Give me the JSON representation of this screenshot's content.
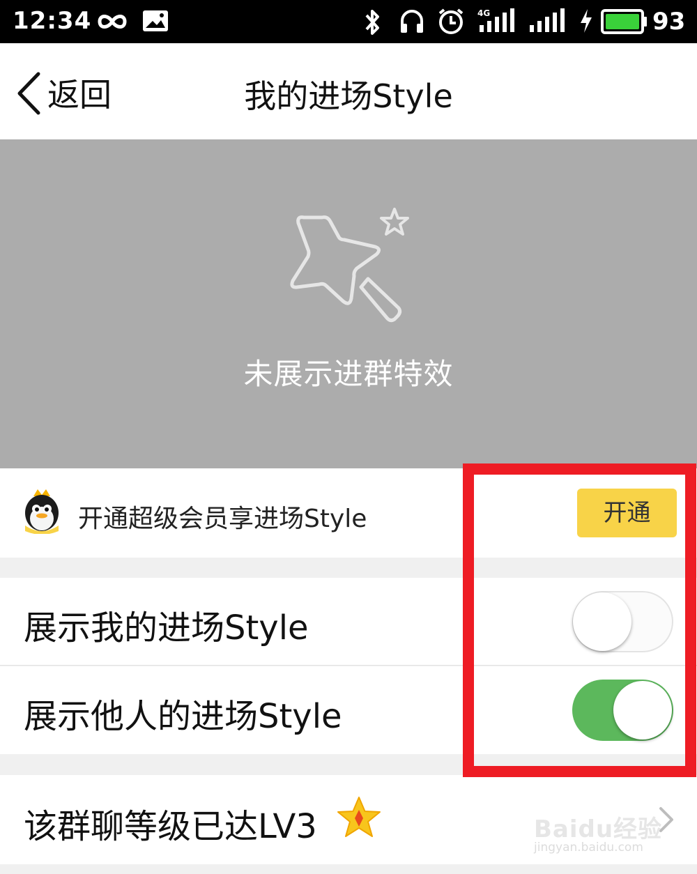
{
  "status_bar": {
    "time": "12:34",
    "battery_level": "93",
    "icons": [
      "infinity-icon",
      "image-notification-icon",
      "bluetooth-icon",
      "headset-icon",
      "alarm-icon",
      "4g-signal-icon",
      "signal-icon",
      "charging-icon",
      "battery-icon"
    ]
  },
  "nav": {
    "back_label": "返回",
    "title": "我的进场Style"
  },
  "banner": {
    "icon": "magic-wand-star-icon",
    "empty_text": "未展示进群特效"
  },
  "vip": {
    "label": "开通超级会员享进场Style",
    "button_label": "开通",
    "button_color": "#f8d348"
  },
  "settings": {
    "show_mine": {
      "label": "展示我的进场Style",
      "enabled": false
    },
    "show_others": {
      "label": "展示他人的进场Style",
      "enabled": true
    }
  },
  "level": {
    "label": "该群聊等级已达LV3",
    "icon": "star-badge-icon"
  },
  "watermark": {
    "brand": "Baidu经验",
    "url": "jingyan.baidu.com"
  },
  "colors": {
    "toggle_on": "#5cb85c",
    "highlight": "#ee1c24",
    "banner_bg": "#acacac"
  }
}
